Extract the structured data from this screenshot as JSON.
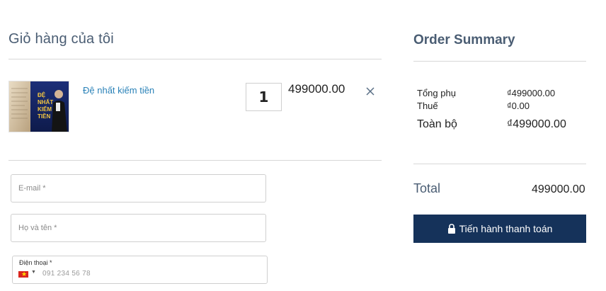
{
  "cart": {
    "title": "Giỏ hàng của tôi",
    "item": {
      "name": "Đệ nhất kiếm tiền",
      "quantity": "1",
      "price": "499000.00",
      "thumb_text": "ĐỆ NHẤT KIẾM TIỀN"
    }
  },
  "form": {
    "email_placeholder": "E-mail *",
    "name_placeholder": "Họ và tên *",
    "phone_label": "Điện thoại *",
    "phone_placeholder": "091 234 56 78"
  },
  "summary": {
    "title": "Order Summary",
    "subtotal_label": "Tổng phụ",
    "subtotal_value": "₫499000.00",
    "tax_label": "Thuế",
    "tax_value": "₫0.00",
    "grand_label": "Toàn bộ",
    "grand_value": "₫499000.00",
    "total_label": "Total",
    "total_value": "499000.00",
    "checkout_label": "Tiến hành thanh toán"
  },
  "colors": {
    "accent": "#15325a",
    "link": "#2a82b8",
    "heading": "#4a5d73"
  }
}
